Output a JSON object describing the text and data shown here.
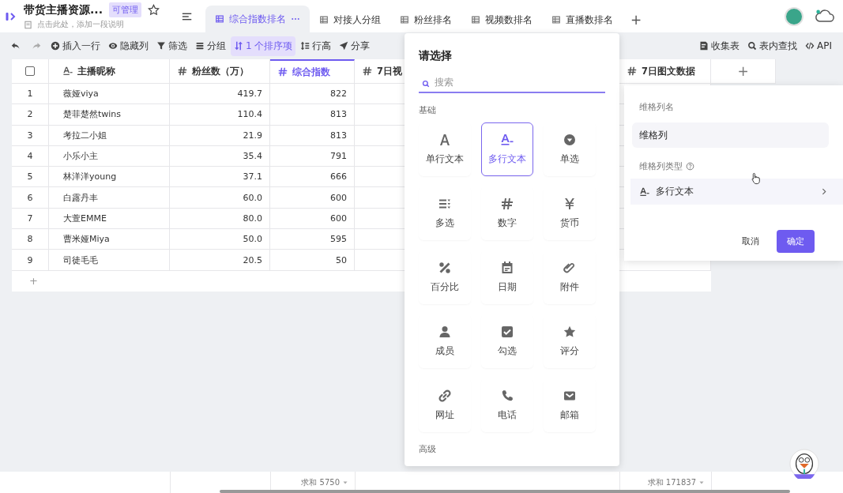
{
  "header": {
    "title": "带货主播资源...",
    "badge": "可管理",
    "subtitle": "点击此处，添加一段说明"
  },
  "tabs": [
    {
      "label": "综合指数排名",
      "selected": true
    },
    {
      "label": "对接人分组",
      "selected": false
    },
    {
      "label": "粉丝排名",
      "selected": false
    },
    {
      "label": "视频数排名",
      "selected": false
    },
    {
      "label": "直播数排名",
      "selected": false
    }
  ],
  "add_tab": "+",
  "toolbar": {
    "left": [
      {
        "disabled": false
      },
      {
        "disabled": true
      },
      {
        "label": "插入一行",
        "selected": false
      },
      {
        "label": "隐藏列",
        "selected": false
      },
      {
        "label": "筛选",
        "selected": false
      },
      {
        "label": "分组",
        "selected": false
      },
      {
        "label": "1 个排序项",
        "selected": true
      },
      {
        "label": "行高",
        "selected": false
      },
      {
        "label": "分享",
        "selected": false
      }
    ],
    "right": [
      {
        "label": "收集表"
      },
      {
        "label": "表内查找"
      },
      {
        "label": "API"
      }
    ]
  },
  "table": {
    "select_all": {
      "checked": false
    },
    "columns": [
      {
        "label": "主播昵称",
        "active": false
      },
      {
        "label": "粉丝数（万）",
        "active": false
      },
      {
        "label": "综合指数",
        "active": true,
        "sum": "求和 5750"
      },
      {
        "label": "7日视",
        "active": false
      },
      {
        "label": "7日图文数据",
        "active": false,
        "sum": "求和 171837"
      }
    ],
    "add_column": "+",
    "rows": [
      [
        "1",
        "薇娅viya",
        "419.7",
        "822"
      ],
      [
        "2",
        "楚菲楚然twins",
        "110.4",
        "813"
      ],
      [
        "3",
        "考拉二小姐",
        "21.9",
        "813"
      ],
      [
        "4",
        "小乐小主",
        "35.4",
        "791"
      ],
      [
        "5",
        "林洋洋young",
        "37.1",
        "666"
      ],
      [
        "6",
        "白露丹丰",
        "60.0",
        "600"
      ],
      [
        "7",
        "大萱EMME",
        "80.0",
        "600"
      ],
      [
        "8",
        "曹米娅Miya",
        "50.0",
        "595"
      ],
      [
        "9",
        "司徒毛毛",
        "20.5",
        "50"
      ]
    ],
    "add_row": "+"
  },
  "picker": {
    "title": "请选择",
    "search": {
      "placeholder": "搜索"
    },
    "sections": [
      {
        "title": "基础",
        "items": [
          {
            "label": "单行文本",
            "selected": false
          },
          {
            "label": "多行文本",
            "selected": true
          },
          {
            "label": "单选",
            "selected": false
          },
          {
            "label": "多选",
            "selected": false
          },
          {
            "label": "数字",
            "selected": false
          },
          {
            "label": "货币",
            "selected": false
          },
          {
            "label": "百分比",
            "selected": false
          },
          {
            "label": "日期",
            "selected": false
          },
          {
            "label": "附件",
            "selected": false
          },
          {
            "label": "成员",
            "selected": false
          },
          {
            "label": "勾选",
            "selected": false
          },
          {
            "label": "评分",
            "selected": false
          },
          {
            "label": "网址",
            "selected": false
          },
          {
            "label": "电话",
            "selected": false
          },
          {
            "label": "邮箱",
            "selected": false
          }
        ]
      },
      {
        "title": "高级"
      }
    ]
  },
  "column_settings": {
    "name_label": "维格列名",
    "name_value": "维格列",
    "type_label": "维格列类型",
    "type_value": "多行文本",
    "cancel": "取消",
    "confirm": "确定"
  }
}
